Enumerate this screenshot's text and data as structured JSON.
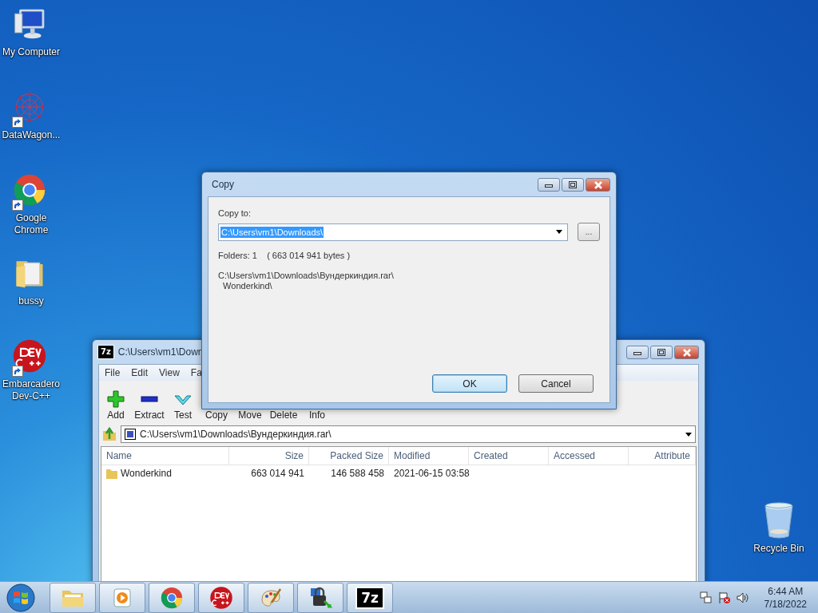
{
  "desktop_icons": [
    {
      "label": "My Computer",
      "kind": "computer",
      "shortcut": false
    },
    {
      "label": "DataWagon...",
      "kind": "network",
      "shortcut": true
    },
    {
      "label": "Google Chrome",
      "kind": "chrome",
      "shortcut": true
    },
    {
      "label": "bussy",
      "kind": "folder",
      "shortcut": false
    },
    {
      "label": "Embarcadero Dev-C++",
      "kind": "devcpp",
      "shortcut": true
    }
  ],
  "recycle_bin": {
    "label": "Recycle Bin"
  },
  "archive_window": {
    "title": "C:\\Users\\vm1\\Down",
    "app_badge": "7z",
    "menu": [
      "File",
      "Edit",
      "View",
      "Fa"
    ],
    "toolbar": [
      {
        "label": "Add",
        "kind": "add"
      },
      {
        "label": "Extract",
        "kind": "extract"
      },
      {
        "label": "Test",
        "kind": "test"
      },
      {
        "label": "Copy",
        "kind": "none"
      },
      {
        "label": "Move",
        "kind": "none"
      },
      {
        "label": "Delete",
        "kind": "none"
      },
      {
        "label": "Info",
        "kind": "none"
      }
    ],
    "address": "C:\\Users\\vm1\\Downloads\\Вундеркиндия.rar\\",
    "columns": [
      "Name",
      "Size",
      "Packed Size",
      "Modified",
      "Created",
      "Accessed",
      "Attribute"
    ],
    "rows": [
      {
        "name": "Wonderkind",
        "size": "663 014 941",
        "packed_size": "146 588 458",
        "modified": "2021-06-15 03:58"
      }
    ]
  },
  "copy_dialog": {
    "title": "Copy",
    "label": "Copy to:",
    "value": "C:\\Users\\vm1\\Downloads\\",
    "value_selected": true,
    "browse": "...",
    "info": "Folders: 1    ( 663 014 941 bytes )",
    "paths": [
      "C:\\Users\\vm1\\Downloads\\Вундеркиндия.rar\\",
      "  Wonderkind\\"
    ],
    "buttons": [
      {
        "label": "OK",
        "default": true
      },
      {
        "label": "Cancel",
        "default": false
      }
    ]
  },
  "taskbar": {
    "items": [
      {
        "kind": "explorer"
      },
      {
        "kind": "media"
      },
      {
        "kind": "chrome"
      },
      {
        "kind": "devcpp"
      },
      {
        "kind": "paint"
      },
      {
        "kind": "vpn"
      },
      {
        "kind": "sevenzip",
        "label": "7z"
      }
    ],
    "tray": [
      {
        "kind": "network"
      },
      {
        "kind": "flag"
      },
      {
        "kind": "volume"
      }
    ],
    "time": "6:44 AM",
    "date": "7/18/2022"
  }
}
